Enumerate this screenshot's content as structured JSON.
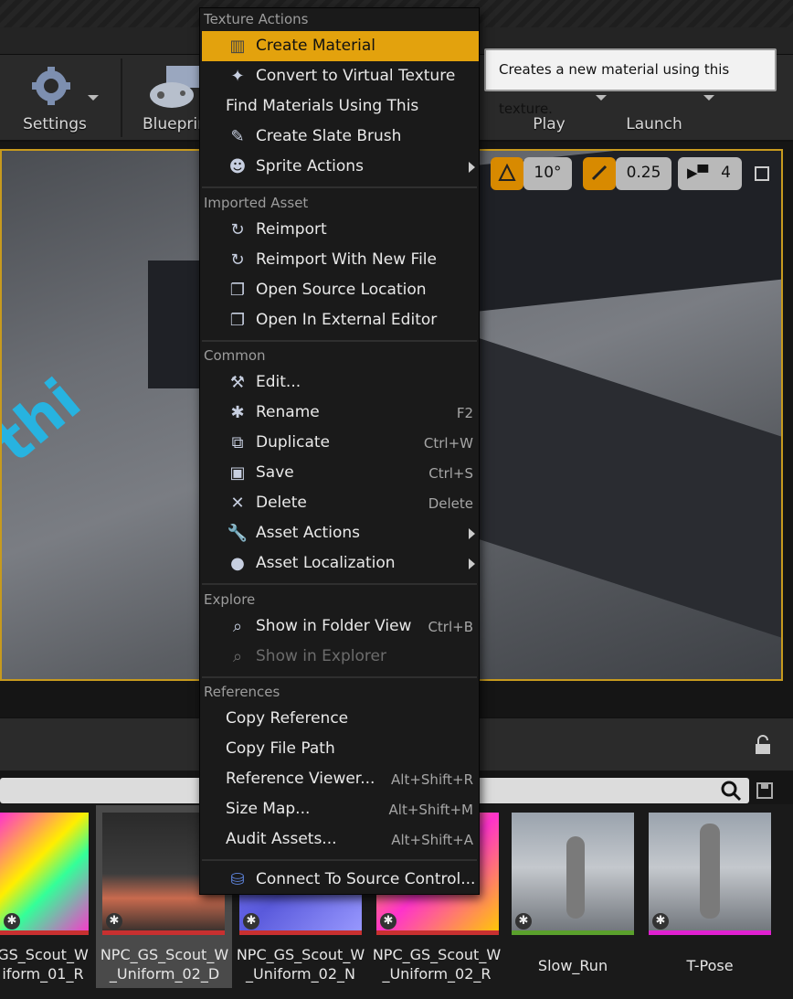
{
  "toolbar": {
    "settings_label": "Settings",
    "blueprints_label": "Blueprints",
    "play_label": "Play",
    "launch_label": "Launch"
  },
  "viewport": {
    "angle_value": "10°",
    "scale_value": "0.25",
    "camera_speed": "4"
  },
  "tooltip": "Creates a new material using this texture.",
  "menu": {
    "texture_actions": {
      "header": "Texture Actions",
      "items": [
        {
          "label": "Create Material",
          "icon": "material-icon"
        },
        {
          "label": "Convert to Virtual Texture",
          "icon": "virtual-texture-icon"
        },
        {
          "label": "Find Materials Using This",
          "icon": ""
        },
        {
          "label": "Create Slate Brush",
          "icon": "brush-icon"
        },
        {
          "label": "Sprite Actions",
          "icon": "sprite-icon"
        }
      ]
    },
    "imported_asset": {
      "header": "Imported Asset",
      "items": [
        {
          "label": "Reimport"
        },
        {
          "label": "Reimport With New File"
        },
        {
          "label": "Open Source Location"
        },
        {
          "label": "Open In External Editor"
        }
      ]
    },
    "common": {
      "header": "Common",
      "items": [
        {
          "label": "Edit...",
          "shortcut": ""
        },
        {
          "label": "Rename",
          "shortcut": "F2"
        },
        {
          "label": "Duplicate",
          "shortcut": "Ctrl+W"
        },
        {
          "label": "Save",
          "shortcut": "Ctrl+S"
        },
        {
          "label": "Delete",
          "shortcut": "Delete"
        },
        {
          "label": "Asset Actions",
          "shortcut": ""
        },
        {
          "label": "Asset Localization",
          "shortcut": ""
        }
      ]
    },
    "explore": {
      "header": "Explore",
      "items": [
        {
          "label": "Show in Folder View",
          "shortcut": "Ctrl+B"
        },
        {
          "label": "Show in Explorer",
          "shortcut": ""
        }
      ]
    },
    "references": {
      "header": "References",
      "items": [
        {
          "label": "Copy Reference",
          "shortcut": ""
        },
        {
          "label": "Copy File Path",
          "shortcut": ""
        },
        {
          "label": "Reference Viewer...",
          "shortcut": "Alt+Shift+R"
        },
        {
          "label": "Size Map...",
          "shortcut": "Alt+Shift+M"
        },
        {
          "label": "Audit Assets...",
          "shortcut": "Alt+Shift+A"
        }
      ]
    },
    "source_control": {
      "label": "Connect To Source Control..."
    }
  },
  "assets": [
    {
      "line1": "GS_Scout_W",
      "line2": "iform_01_R",
      "strip": "#c83030"
    },
    {
      "line1": "NPC_GS_Scout_W",
      "line2": "_Uniform_02_D",
      "strip": "#c83030"
    },
    {
      "line1": "NPC_GS_Scout_W",
      "line2": "_Uniform_02_N",
      "strip": "#c83030"
    },
    {
      "line1": "NPC_GS_Scout_W",
      "line2": "_Uniform_02_R",
      "strip": "#c83030"
    },
    {
      "line1": "Slow_Run",
      "line2": "",
      "strip": "#5aa02c"
    },
    {
      "line1": "T-Pose",
      "line2": "",
      "strip": "#e020d0"
    }
  ]
}
